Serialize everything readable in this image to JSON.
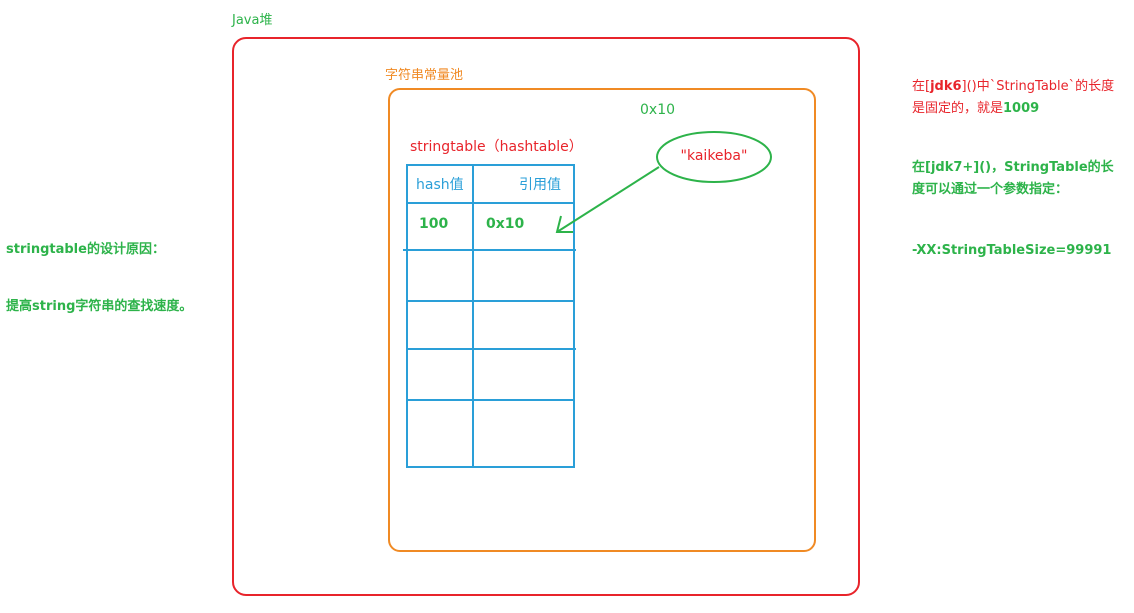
{
  "heap": {
    "label": "Java堆"
  },
  "pool": {
    "label": "字符串常量池"
  },
  "string_address": "0x10",
  "string_literal": "\"kaikeba\"",
  "table": {
    "title": "stringtable（hashtable）",
    "headers": {
      "hash": "hash值",
      "ref": "引用值"
    },
    "row": {
      "hash": "100",
      "ref": "0x10"
    }
  },
  "left_notes": {
    "reason_title": "stringtable的设计原因：",
    "reason_text": "提高string字符串的查找速度。"
  },
  "right_notes": {
    "jdk6_prefix": "在[",
    "jdk6_version": "jdk6",
    "jdk6_mid": "]()中`StringTable`的长度",
    "jdk6_line2": "是固定的，就是",
    "jdk6_size": "1009",
    "jdk7_line1": "在[jdk7+]()，StringTable的长",
    "jdk7_line2": "度可以通过一个参数指定：",
    "jvm_param": "-XX:StringTableSize=99991"
  },
  "colors": {
    "heap_border": "#e8242b",
    "pool_border": "#f08a24",
    "table_border": "#2a9fd8",
    "accent_green": "#2db34a",
    "accent_red": "#e8242b"
  }
}
